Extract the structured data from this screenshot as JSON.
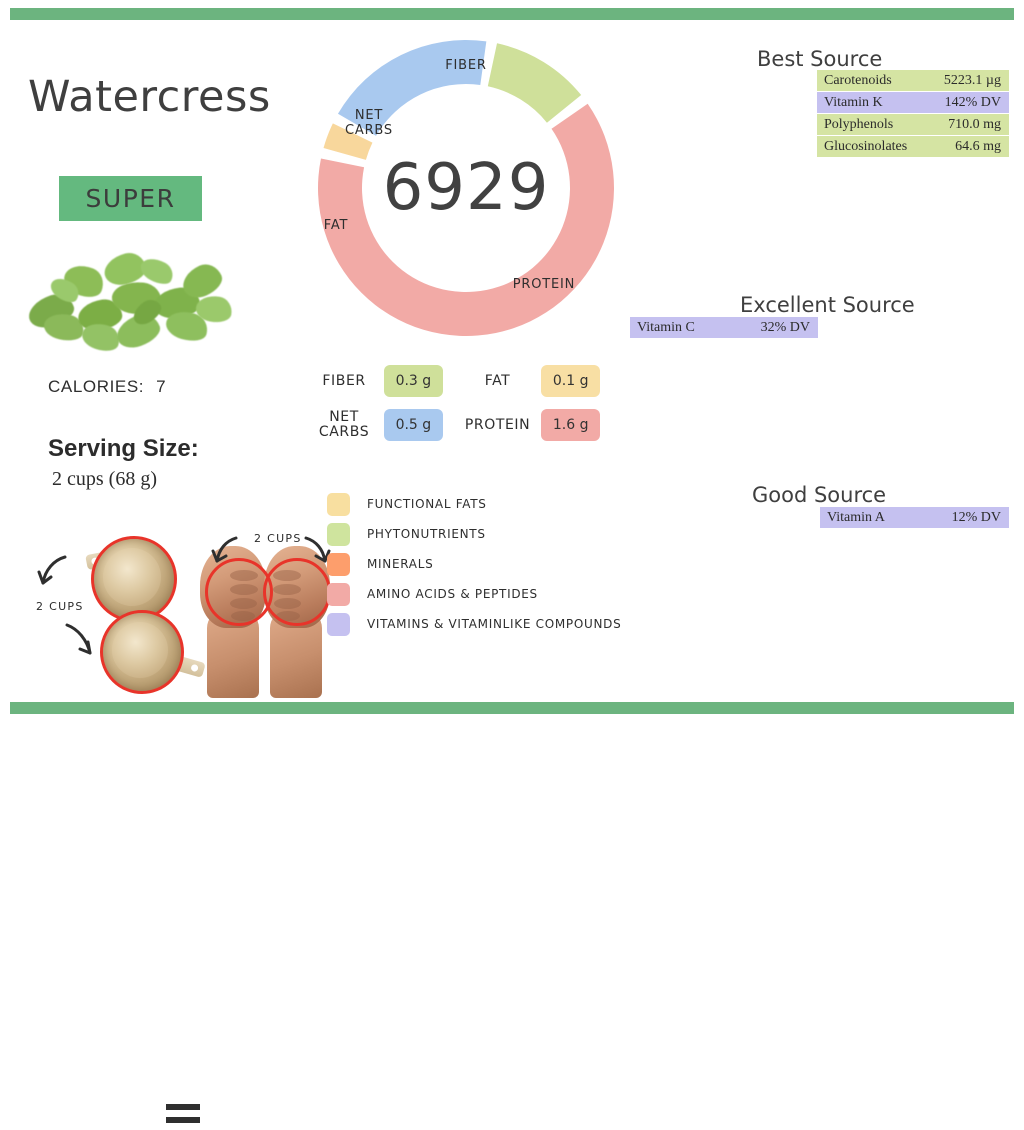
{
  "bands": {
    "color": "#6cb47f"
  },
  "food": {
    "title": "Watercress",
    "badge": "SUPER",
    "calories_label": "CALORIES:",
    "calories_value": "7",
    "serving_title": "Serving Size:",
    "serving_value": "2 cups (68 g)"
  },
  "equivalence": {
    "label_left": "2 CUPS",
    "label_right": "2 CUPS",
    "equals": "="
  },
  "donut": {
    "center_value": "6929",
    "labels": {
      "fiber": "FIBER",
      "net_carbs": "NET\nCARBS",
      "fat": "FAT",
      "protein": "PROTEIN"
    }
  },
  "chart_data": {
    "type": "pie",
    "title": "Macronutrient distribution",
    "center_label": "6929",
    "categories": [
      "FIBER",
      "PROTEIN",
      "FAT",
      "NET CARBS"
    ],
    "values": [
      0.3,
      1.6,
      0.1,
      0.5
    ],
    "units": "g",
    "colors": [
      "#cfe09a",
      "#f2aaa6",
      "#f8d79c",
      "#a9c9ef"
    ],
    "start_angle_deg": 10,
    "legend": "inline-labels",
    "grid": false
  },
  "macros": [
    {
      "name": "FIBER",
      "value": "0.3 g",
      "color": "#cfe09a"
    },
    {
      "name": "FAT",
      "value": "0.1 g",
      "color": "#f8dfa4"
    },
    {
      "name": "NET\nCARBS",
      "value": "0.5 g",
      "color": "#a9c9ef"
    },
    {
      "name": "PROTEIN",
      "value": "1.6 g",
      "color": "#f2aaa6"
    }
  ],
  "legend": [
    {
      "label": "FUNCTIONAL  FATS",
      "color": "#f8dfa0"
    },
    {
      "label": "PHYTONUTRIENTS",
      "color": "#cfe49e"
    },
    {
      "label": "MINERALS",
      "color": "#fd9e6c"
    },
    {
      "label": "AMINO ACIDS & PEPTIDES",
      "color": "#f2aaa6"
    },
    {
      "label": "VITAMINS & VITAMINLIKE COMPOUNDS",
      "color": "#c5c1f0"
    }
  ],
  "sources": {
    "best": {
      "heading": "Best Source",
      "rows": [
        {
          "name": "Carotenoids",
          "value": "5223.1 µg",
          "color": "#d5e4a3"
        },
        {
          "name": "Vitamin K",
          "value": "142% DV",
          "color": "#c5c1f0"
        },
        {
          "name": "Polyphenols",
          "value": "710.0 mg",
          "color": "#d5e4a3"
        },
        {
          "name": "Glucosinolates",
          "value": "64.6 mg",
          "color": "#d5e4a3"
        }
      ]
    },
    "excellent": {
      "heading": "Excellent Source",
      "rows": [
        {
          "name": "Vitamin C",
          "value": "32% DV",
          "color": "#c5c1f0"
        }
      ]
    },
    "good": {
      "heading": "Good Source",
      "rows": [
        {
          "name": "Vitamin A",
          "value": "12% DV",
          "color": "#c5c1f0"
        }
      ]
    }
  }
}
